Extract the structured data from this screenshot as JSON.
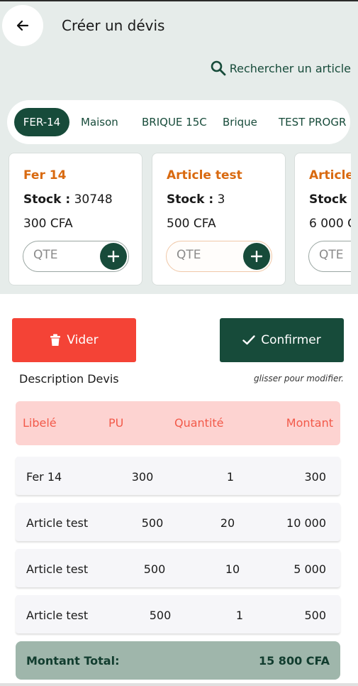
{
  "header": {
    "title": "Créer un dévis"
  },
  "search": {
    "label": "Rechercher un article"
  },
  "categories": [
    "FER-14",
    "Maison",
    "BRIQUE 15C",
    "Brique",
    "TEST PROGR"
  ],
  "products": [
    {
      "name": "Fer 14",
      "stock_label": "Stock :",
      "stock": "30748",
      "price": "300 CFA",
      "qty_placeholder": "QTE"
    },
    {
      "name": "Article test",
      "stock_label": "Stock :",
      "stock": "3",
      "price": "500 CFA",
      "qty_placeholder": "QTE"
    },
    {
      "name": "Article",
      "stock_label": "Stock :",
      "stock": "",
      "price": "6 000 C",
      "qty_placeholder": "QTE"
    }
  ],
  "actions": {
    "clear_label": "Vider",
    "confirm_label": "Confirmer"
  },
  "quote": {
    "description_label": "Description Devis",
    "hint": "glisser pour modifier.",
    "columns": [
      "Libelé",
      "PU",
      "Quantité",
      "Montant"
    ],
    "rows": [
      {
        "label": "Fer 14",
        "pu": "300",
        "qty": "1",
        "amount": "300"
      },
      {
        "label": "Article test",
        "pu": "500",
        "qty": "20",
        "amount": "10 000"
      },
      {
        "label": "Article test",
        "pu": "500",
        "qty": "10",
        "amount": "5 000"
      },
      {
        "label": "Article test",
        "pu": "500",
        "qty": "1",
        "amount": "500"
      }
    ],
    "total_label": "Montant Total:",
    "total_value": "15 800 CFA"
  },
  "colors": {
    "primary": "#174b3a",
    "danger": "#f44336",
    "accent": "#d96a10",
    "header_bg": "#fdd3d1"
  },
  "icons": {
    "back": "arrow-left-icon",
    "search": "search-icon",
    "add": "plus-icon",
    "clear": "trash-icon",
    "confirm": "check-icon"
  }
}
